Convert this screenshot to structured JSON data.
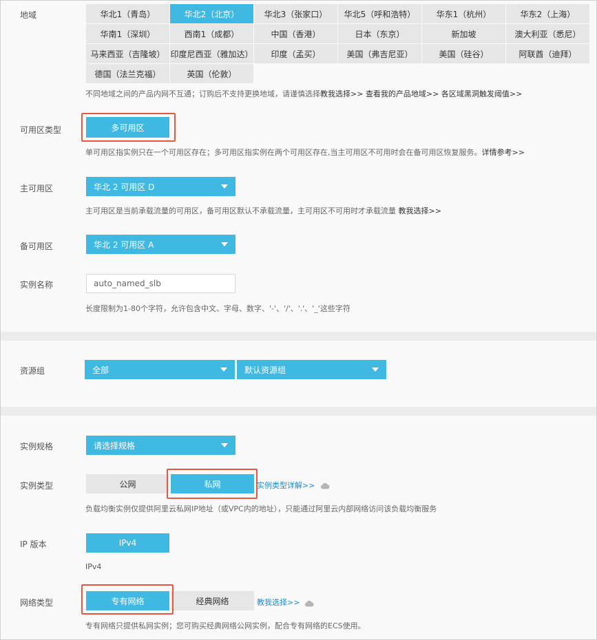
{
  "region": {
    "label": "地域",
    "items": [
      {
        "name": "华北1（青岛）",
        "selected": false
      },
      {
        "name": "华北2（北京）",
        "selected": true
      },
      {
        "name": "华北3（张家口）",
        "selected": false
      },
      {
        "name": "华北5（呼和浩特）",
        "selected": false
      },
      {
        "name": "华东1（杭州）",
        "selected": false
      },
      {
        "name": "华东2（上海）",
        "selected": false
      },
      {
        "name": "华南1（深圳）",
        "selected": false
      },
      {
        "name": "西南1（成都）",
        "selected": false
      },
      {
        "name": "中国（香港）",
        "selected": false
      },
      {
        "name": "日本（东京）",
        "selected": false
      },
      {
        "name": "新加坡",
        "selected": false
      },
      {
        "name": "澳大利亚（悉尼）",
        "selected": false
      },
      {
        "name": "马来西亚（吉隆坡）",
        "selected": false
      },
      {
        "name": "印度尼西亚（雅加达）",
        "selected": false
      },
      {
        "name": "印度（孟买）",
        "selected": false
      },
      {
        "name": "美国（弗吉尼亚）",
        "selected": false
      },
      {
        "name": "美国（硅谷）",
        "selected": false
      },
      {
        "name": "阿联酋（迪拜）",
        "selected": false
      },
      {
        "name": "德国（法兰克福）",
        "selected": false
      },
      {
        "name": "英国（伦敦）",
        "selected": false
      }
    ],
    "hint_text": "不同地域之间的产品内网不互通；订购后不支持更换地域，请谨慎选择",
    "link_teach": "教我选择>>",
    "link_my_regions": "查看我的产品地域>>",
    "link_blackhole": "各区域黑洞触发阈值>>"
  },
  "zone_type": {
    "label": "可用区类型",
    "button": "多可用区",
    "hint_text": "单可用区指实例只在一个可用区存在；多可用区指实例在两个可用区存在,当主可用区不可用时会在备可用区恢复服务。",
    "link_detail": "详情参考>>"
  },
  "primary_zone": {
    "label": "主可用区",
    "value": "华北 2 可用区 D",
    "hint_text": "主可用区是当前承载流量的可用区，备可用区默认不承载流量，主可用区不可用时才承载流量",
    "link_teach": "教我选择>>"
  },
  "backup_zone": {
    "label": "备可用区",
    "value": "华北 2 可用区 A"
  },
  "instance_name": {
    "label": "实例名称",
    "value": "auto_named_slb",
    "hint_text": "长度限制为1-80个字符，允许包含中文、字母、数字、'-'、'/'、'.'、'_'这些字符"
  },
  "resource_group": {
    "label": "资源组",
    "select1": "全部",
    "select2": "默认资源组"
  },
  "instance_spec": {
    "label": "实例规格",
    "value": "请选择规格"
  },
  "instance_type": {
    "label": "实例类型",
    "option_public": "公网",
    "option_private": "私网",
    "selected": "私网",
    "link_detail": "实例类型详解>>",
    "hint_text": "负载均衡实例仅提供阿里云私网IP地址（或VPC内的地址），只能通过阿里云内部网络访问该负载均衡服务"
  },
  "ip_version": {
    "label": "IP 版本",
    "button": "IPv4",
    "value_text": "IPv4"
  },
  "network_type": {
    "label": "网络类型",
    "option_vpc": "专有网络",
    "option_classic": "经典网络",
    "selected": "专有网络",
    "link_teach": "教我选择>>",
    "hint_text": "专有网络只提供私网实例；您可购买经典网络公网实例，配合专有网络的ECS使用。"
  },
  "colors": {
    "accent": "#3fb9e2",
    "highlight_border": "#e5583f",
    "section_bg": "#f9f9f9",
    "gap_bg": "#ececec"
  },
  "icons": [
    "cloud-icon",
    "chevron-down-icon"
  ]
}
